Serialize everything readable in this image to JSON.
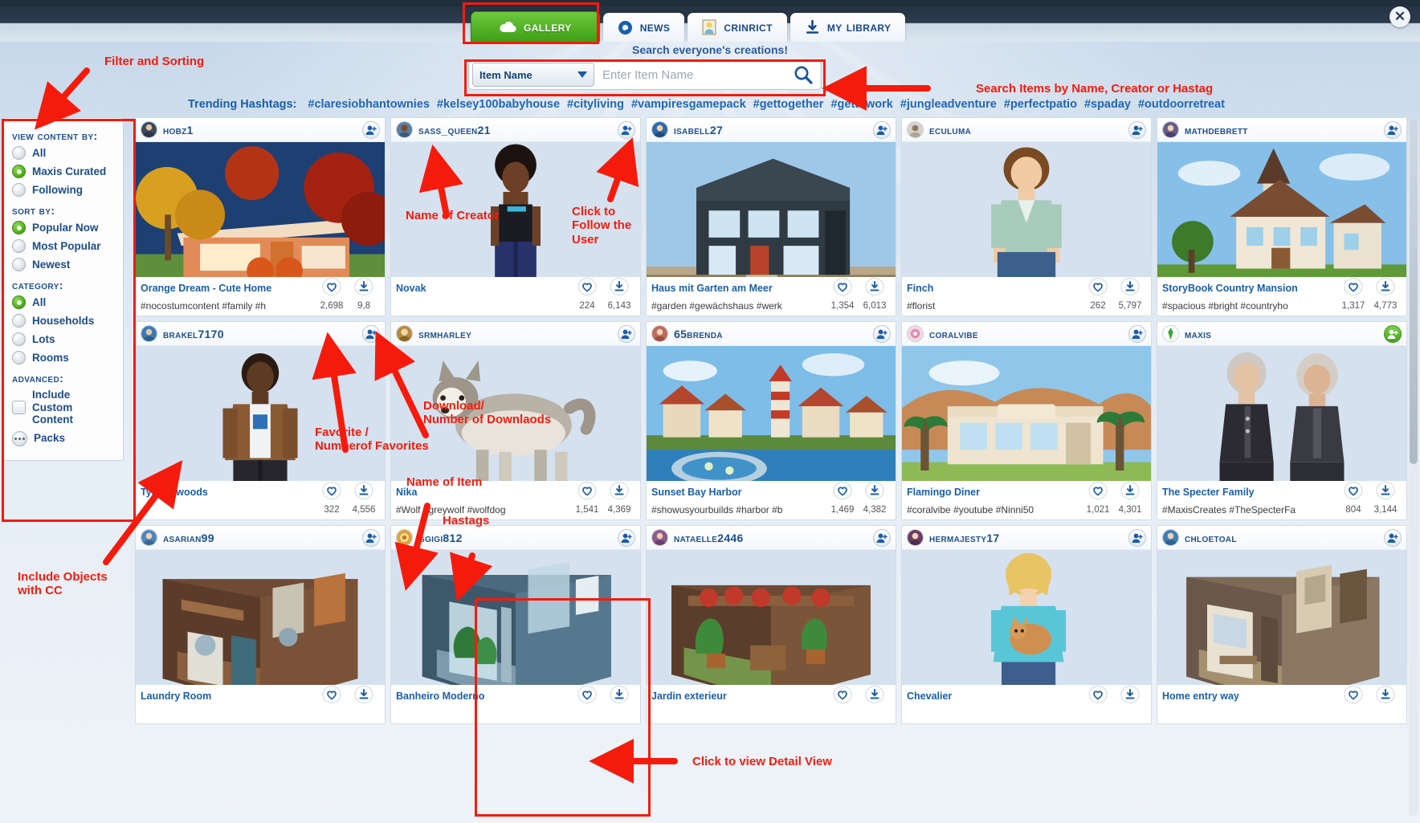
{
  "window": {
    "close_label": "✕"
  },
  "tabs": [
    {
      "label": "Gallery",
      "icon": "cloud-icon",
      "active": true
    },
    {
      "label": "News",
      "icon": "origin-q-icon",
      "active": false
    },
    {
      "label": "Crinrict",
      "icon": "user-portrait-icon",
      "active": false
    },
    {
      "label": "My Library",
      "icon": "download-icon",
      "active": false
    }
  ],
  "search": {
    "headline": "Search everyone's creations!",
    "dropdown_value": "Item Name",
    "placeholder": "Enter Item Name",
    "icon": "magnifier-icon"
  },
  "hashtags": {
    "label": "Trending Hashtags:",
    "items": [
      "#claresiobhantownies",
      "#kelsey100babyhouse",
      "#cityliving",
      "#vampiresgamepack",
      "#gettogether",
      "#gettowork",
      "#jungleadventure",
      "#perfectpatio",
      "#spaday",
      "#outdoorretreat"
    ]
  },
  "sidebar": {
    "groups": [
      {
        "title": "View Content By:",
        "type": "radio",
        "options": [
          {
            "label": "All",
            "selected": false
          },
          {
            "label": "Maxis Curated",
            "selected": true
          },
          {
            "label": "Following",
            "selected": false
          }
        ]
      },
      {
        "title": "Sort By:",
        "type": "radio",
        "options": [
          {
            "label": "Popular Now",
            "selected": true
          },
          {
            "label": "Most Popular",
            "selected": false
          },
          {
            "label": "Newest",
            "selected": false
          }
        ]
      },
      {
        "title": "Category:",
        "type": "radio",
        "options": [
          {
            "label": "All",
            "selected": true
          },
          {
            "label": "Households",
            "selected": false
          },
          {
            "label": "Lots",
            "selected": false
          },
          {
            "label": "Rooms",
            "selected": false
          }
        ]
      },
      {
        "title": "Advanced:",
        "type": "mixed",
        "options": [
          {
            "label": "Include Custom Content",
            "control": "checkbox",
            "selected": false
          },
          {
            "label": "Packs",
            "control": "dots",
            "selected": false
          }
        ]
      }
    ]
  },
  "cards": [
    {
      "creator": "Hobz1",
      "name": "Orange Dream - Cute Home",
      "tags": "#nocostumcontent #family #h",
      "favorites": "2,698",
      "downloads": "9,8",
      "art": "house-autumn",
      "avatar": "#3a4a5c",
      "follow_green": false
    },
    {
      "creator": "Sass_Queen21",
      "name": "Novak",
      "tags": "",
      "favorites": "224",
      "downloads": "6,143",
      "art": "sim-female-dark",
      "avatar": "#5b7d9e",
      "follow_green": false
    },
    {
      "creator": "Isabell27",
      "name": "Haus mit Garten am Meer",
      "tags": "#garden #gewächshaus #werk",
      "favorites": "1,354",
      "downloads": "6,013",
      "art": "house-modern-dark",
      "avatar": "#2f6aa8",
      "follow_green": false
    },
    {
      "creator": "Eculuma",
      "name": "Finch",
      "tags": "#florist",
      "favorites": "262",
      "downloads": "5,797",
      "art": "sim-female-green",
      "avatar": "#8d7767",
      "follow_green": false
    },
    {
      "creator": "Mathdebrett",
      "name": "StoryBook Country Mansion",
      "tags": "#spacious #bright #countryho",
      "favorites": "1,317",
      "downloads": "4,773",
      "art": "house-victorian",
      "avatar": "#6a5a8c",
      "follow_green": false
    },
    {
      "creator": "Brakel7170",
      "name": "Tyrone woods",
      "tags": "",
      "favorites": "322",
      "downloads": "4,556",
      "art": "sim-male-jacket",
      "avatar": "#3c7ab5",
      "follow_green": false
    },
    {
      "creator": "Srmharley",
      "name": "Nika",
      "tags": "#Wolf #greywolf #wolfdog",
      "favorites": "1,541",
      "downloads": "4,369",
      "art": "dog-husky",
      "avatar": "#b98a3a",
      "follow_green": false
    },
    {
      "creator": "65Brenda",
      "name": "Sunset Bay Harbor",
      "tags": "#showusyourbuilds #harbor #b",
      "favorites": "1,469",
      "downloads": "4,382",
      "art": "harbor-town",
      "avatar": "#c06a5a",
      "follow_green": false
    },
    {
      "creator": "Coralvibe",
      "name": "Flamingo Diner",
      "tags": "#coralvibe #youtube #Ninni50",
      "favorites": "1,021",
      "downloads": "4,301",
      "art": "diner-palms",
      "avatar": "#cf84a8",
      "follow_green": false
    },
    {
      "creator": "Maxis",
      "name": "The Specter Family",
      "tags": "#MaxisCreates #TheSpecterFa",
      "favorites": "804",
      "downloads": "3,144",
      "art": "sims-gothic-pair",
      "avatar": "#2f9d4e",
      "follow_green": true
    },
    {
      "creator": "Asarian99",
      "name": "Laundry Room",
      "tags": "",
      "favorites": "",
      "downloads": "",
      "art": "room-laundry",
      "avatar": "#4e86bd",
      "follow_green": false
    },
    {
      "creator": "Ggigi812",
      "name": "Banheiro Moderno",
      "tags": "",
      "favorites": "",
      "downloads": "",
      "art": "room-bathroom",
      "avatar": "#e0a33c",
      "follow_green": false
    },
    {
      "creator": "Nataelle2446",
      "name": "Jardin exterieur",
      "tags": "",
      "favorites": "",
      "downloads": "",
      "art": "room-garden",
      "avatar": "#8c5a8c",
      "follow_green": false
    },
    {
      "creator": "Hermajesty17",
      "name": "Chevalier",
      "tags": "",
      "favorites": "",
      "downloads": "",
      "art": "sim-female-cat",
      "avatar": "#6b3d63",
      "follow_green": false
    },
    {
      "creator": "Chloetoal",
      "name": "Home entry way",
      "tags": "",
      "favorites": "",
      "downloads": "",
      "art": "room-entry",
      "avatar": "#3f7fb5",
      "follow_green": false
    }
  ],
  "annotations": [
    {
      "id": "filter-sorting",
      "text": "Filter and Sorting"
    },
    {
      "id": "search-items",
      "text": "Search Items by Name, Creator or Hastag"
    },
    {
      "id": "name-of-creator",
      "text": "Name of Creator"
    },
    {
      "id": "click-to-follow",
      "text": "Click to\nFollow the\nUser"
    },
    {
      "id": "favorite-number",
      "text": "Favorite /\nNumberof Favorites"
    },
    {
      "id": "download-number",
      "text": "Download/\nNumber of Downlaods"
    },
    {
      "id": "name-of-item",
      "text": "Name of Item"
    },
    {
      "id": "hashtags-note",
      "text": "Hastags"
    },
    {
      "id": "include-objects-cc",
      "text": "Include Objects\nwith CC"
    },
    {
      "id": "click-detail-view",
      "text": "Click to view Detail View"
    }
  ],
  "colors": {
    "accent_red": "#f51b0c",
    "link_blue": "#1b5ea8",
    "tab_green": "#4fae1c"
  }
}
